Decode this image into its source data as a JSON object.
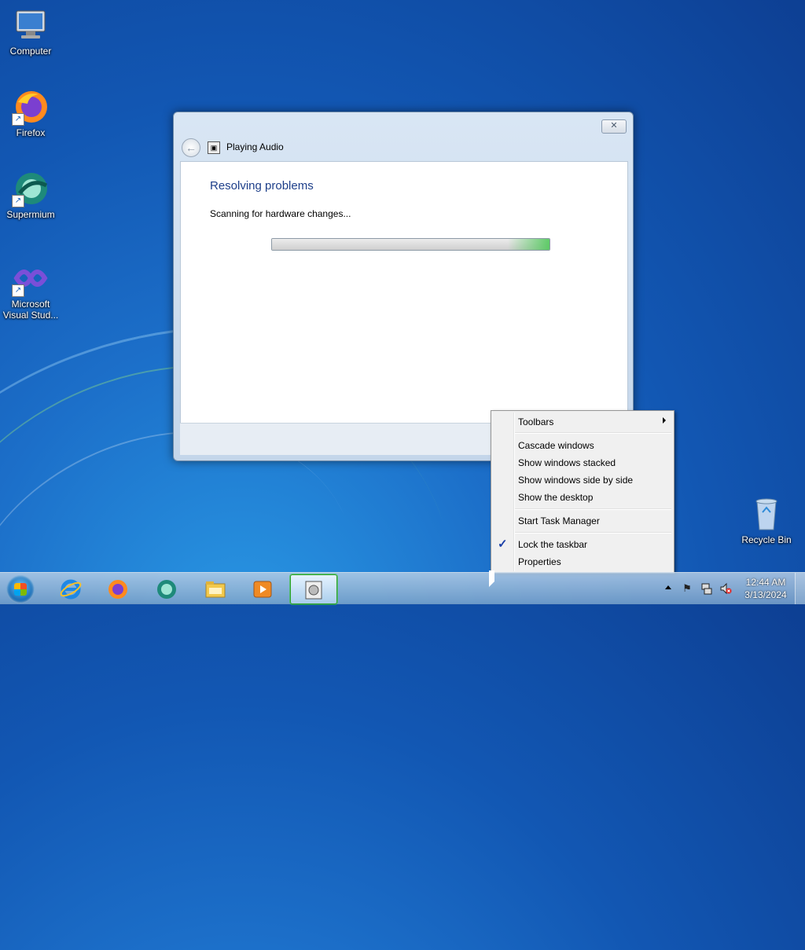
{
  "desktop": {
    "icons": [
      {
        "label": "Computer",
        "icon": "computer-icon"
      },
      {
        "label": "Firefox",
        "icon": "firefox-icon"
      },
      {
        "label": "Supermium",
        "icon": "supermium-icon"
      },
      {
        "label": "Microsoft Visual Stud...",
        "icon": "visual-studio-icon"
      },
      {
        "label": "Recycle Bin",
        "icon": "recycle-bin-icon"
      }
    ]
  },
  "dialog": {
    "title": "Playing Audio",
    "close_symbol": "✕",
    "heading": "Resolving problems",
    "status": "Scanning for hardware changes...",
    "progress_fraction": 1.0
  },
  "context_menu": {
    "items": [
      {
        "label": "Toolbars",
        "submenu": true
      },
      {
        "label": "Cascade windows"
      },
      {
        "label": "Show windows stacked"
      },
      {
        "label": "Show windows side by side"
      },
      {
        "label": "Show the desktop"
      },
      {
        "label": "Start Task Manager"
      },
      {
        "label": "Lock the taskbar",
        "checked": true
      },
      {
        "label": "Properties"
      }
    ]
  },
  "taskbar": {
    "pinned": [
      "internet-explorer-icon",
      "firefox-icon",
      "supermium-icon",
      "file-explorer-icon",
      "media-player-icon",
      "troubleshooter-icon"
    ],
    "clock": {
      "time": "12:44 AM",
      "date": "3/13/2024"
    },
    "tray_icons": [
      "action-center-flag-icon",
      "network-icon",
      "volume-muted-icon"
    ]
  }
}
